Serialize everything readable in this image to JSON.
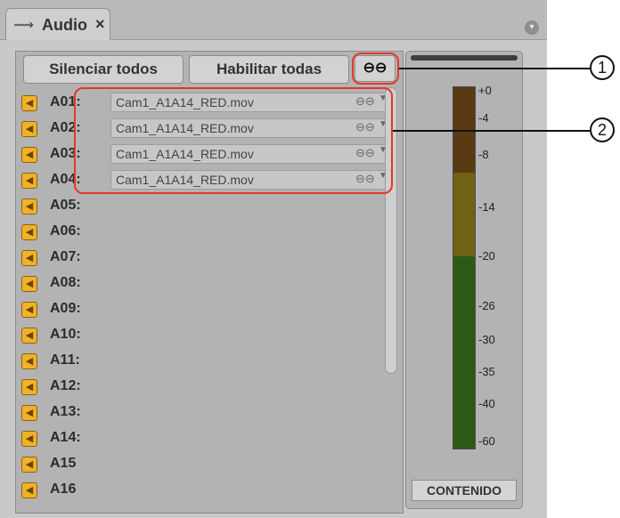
{
  "tab": {
    "icon": "waveform-icon",
    "label": "Audio",
    "close": "×"
  },
  "panel_menu_icon": "circle-chevron-down-icon",
  "toolbar": {
    "mute_all_label": "Silenciar todos",
    "enable_all_label": "Habilitar todas",
    "link_icon": "link-icon"
  },
  "tracks": [
    {
      "label": "A01:",
      "clip": "Cam1_A1A14_RED.mov"
    },
    {
      "label": "A02:",
      "clip": "Cam1_A1A14_RED.mov"
    },
    {
      "label": "A03:",
      "clip": "Cam1_A1A14_RED.mov"
    },
    {
      "label": "A04:",
      "clip": "Cam1_A1A14_RED.mov"
    },
    {
      "label": "A05:"
    },
    {
      "label": "A06:"
    },
    {
      "label": "A07:"
    },
    {
      "label": "A08:"
    },
    {
      "label": "A09:"
    },
    {
      "label": "A10:"
    },
    {
      "label": "A11:"
    },
    {
      "label": "A12:"
    },
    {
      "label": "A13:"
    },
    {
      "label": "A14:"
    },
    {
      "label": "A15"
    },
    {
      "label": "A16"
    }
  ],
  "meter": {
    "ticks": [
      "+0",
      "-4",
      "-8",
      "-14",
      "-20",
      "-26",
      "-30",
      "-35",
      "-40",
      "-60"
    ],
    "colors": {
      "red": "#5a3a12",
      "yellow": "#6f6215",
      "green": "#2e5a16"
    },
    "button_label": "CONTENIDO"
  },
  "callouts": {
    "c1": "1",
    "c2": "2"
  },
  "highlight_color": "#e2392b"
}
